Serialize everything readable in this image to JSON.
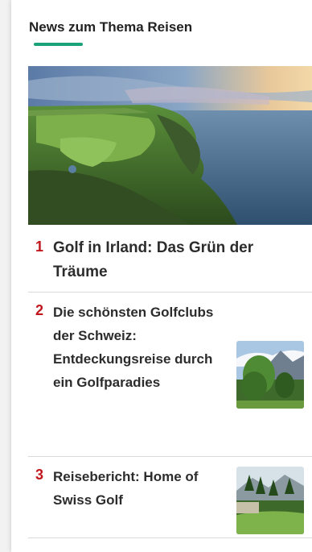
{
  "section": {
    "heading": "News zum Thema Reisen",
    "accent_color": "#1aa37a",
    "rank_color": "#c0171c"
  },
  "hero": {
    "image": "golf-course-cliff-ocean-sunset"
  },
  "articles": [
    {
      "rank": "1",
      "title": "Golf in Irland: Das Grün der Träume",
      "thumbnail": ""
    },
    {
      "rank": "2",
      "title": "Die schönsten Golfclubs der Schweiz: Entdeckungsreise durch ein Golfparadies",
      "thumbnail": "trees-mountains-thumbnail"
    },
    {
      "rank": "3",
      "title": "Reisebericht: Home of Swiss Golf",
      "thumbnail": "golf-course-alpine-thumbnail"
    }
  ]
}
